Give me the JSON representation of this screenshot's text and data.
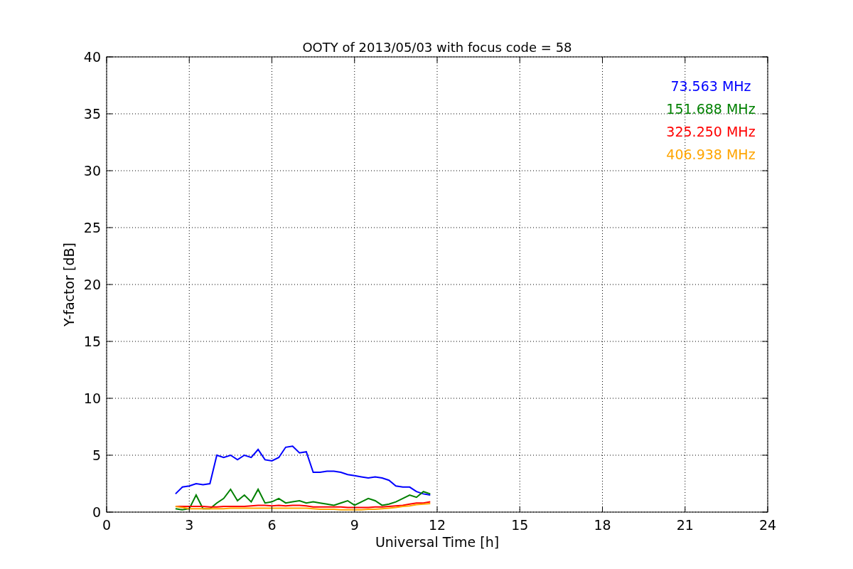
{
  "figure": {
    "chart_data": {
      "type": "line",
      "title": "OOTY of 2013/05/03 with focus code = 58",
      "xlabel": "Universal Time [h]",
      "ylabel": "Y-factor [dB]",
      "x": [
        2.5,
        2.75,
        3,
        3.25,
        3.5,
        3.75,
        4,
        4.25,
        4.5,
        4.75,
        5,
        5.25,
        5.5,
        5.75,
        6,
        6.25,
        6.5,
        6.75,
        7,
        7.25,
        7.5,
        7.75,
        8,
        8.25,
        8.5,
        8.75,
        9,
        9.25,
        9.5,
        9.75,
        10,
        10.25,
        10.5,
        10.75,
        11,
        11.25,
        11.5,
        11.75
      ],
      "series": [
        {
          "name": "73.563 MHz",
          "color": "#0000ff",
          "values": [
            1.6,
            2.2,
            2.3,
            2.5,
            2.4,
            2.5,
            5.0,
            4.8,
            5.0,
            4.6,
            5.0,
            4.8,
            5.5,
            4.6,
            4.5,
            4.8,
            5.7,
            5.8,
            5.2,
            5.3,
            3.5,
            3.5,
            3.6,
            3.6,
            3.5,
            3.3,
            3.2,
            3.1,
            3.0,
            3.1,
            3.0,
            2.8,
            2.3,
            2.2,
            2.2,
            1.8,
            1.6,
            1.5
          ]
        },
        {
          "name": "151.688 MHz",
          "color": "#008000",
          "values": [
            0.3,
            0.2,
            0.3,
            1.5,
            0.3,
            0.3,
            0.8,
            1.2,
            2.0,
            1.0,
            1.5,
            0.9,
            2.0,
            0.8,
            0.9,
            1.2,
            0.8,
            0.9,
            1.0,
            0.8,
            0.9,
            0.8,
            0.7,
            0.6,
            0.8,
            1.0,
            0.6,
            0.9,
            1.2,
            1.0,
            0.6,
            0.7,
            0.9,
            1.2,
            1.5,
            1.3,
            1.8,
            1.6
          ]
        },
        {
          "name": "325.250 MHz",
          "color": "#ff0000",
          "values": [
            0.5,
            0.5,
            0.5,
            0.5,
            0.5,
            0.45,
            0.45,
            0.5,
            0.5,
            0.5,
            0.5,
            0.55,
            0.6,
            0.6,
            0.55,
            0.6,
            0.55,
            0.6,
            0.6,
            0.55,
            0.45,
            0.45,
            0.45,
            0.45,
            0.45,
            0.4,
            0.4,
            0.4,
            0.4,
            0.45,
            0.45,
            0.5,
            0.55,
            0.6,
            0.7,
            0.8,
            0.8,
            0.9
          ]
        },
        {
          "name": "406.938 MHz",
          "color": "#ffa500",
          "values": [
            0.5,
            0.4,
            0.3,
            0.3,
            0.3,
            0.3,
            0.3,
            0.3,
            0.35,
            0.35,
            0.35,
            0.35,
            0.35,
            0.35,
            0.35,
            0.35,
            0.35,
            0.35,
            0.35,
            0.35,
            0.3,
            0.25,
            0.25,
            0.25,
            0.2,
            0.2,
            0.2,
            0.2,
            0.25,
            0.25,
            0.3,
            0.35,
            0.4,
            0.5,
            0.55,
            0.65,
            0.7,
            0.75
          ]
        }
      ],
      "grid": true,
      "xlim": [
        0,
        24
      ],
      "ylim": [
        0,
        40
      ],
      "xticks": [
        0,
        3,
        6,
        9,
        12,
        15,
        18,
        21,
        24
      ],
      "yticks": [
        0,
        5,
        10,
        15,
        20,
        25,
        30,
        35,
        40
      ]
    }
  }
}
